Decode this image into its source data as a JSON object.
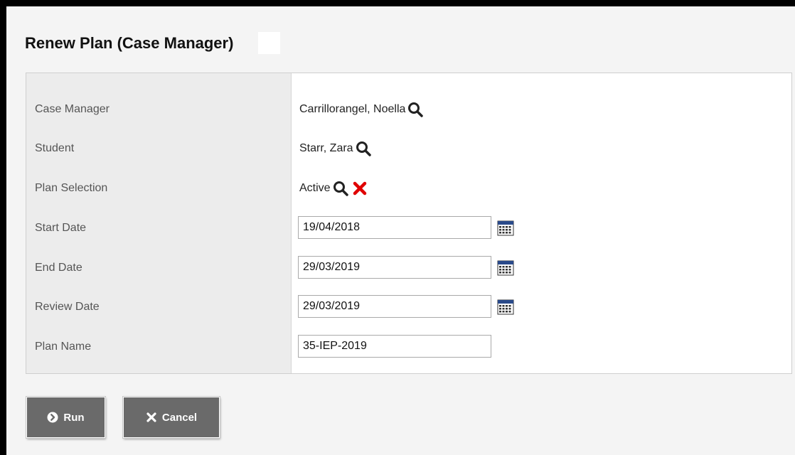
{
  "dialog": {
    "title": "Renew Plan (Case Manager)"
  },
  "form": {
    "fields": [
      {
        "label": "Case Manager",
        "value": "Carrillorangel, Noella"
      },
      {
        "label": "Student",
        "value": "Starr, Zara"
      },
      {
        "label": "Plan Selection",
        "value": "Active"
      },
      {
        "label": "Start Date",
        "value": "19/04/2018"
      },
      {
        "label": "End Date",
        "value": "29/03/2019"
      },
      {
        "label": "Review Date",
        "value": "29/03/2019"
      },
      {
        "label": "Plan Name",
        "value": "35-IEP-2019"
      }
    ]
  },
  "buttons": {
    "run_label": "Run",
    "cancel_label": "Cancel"
  },
  "icons": {
    "search": "search-icon",
    "clear": "clear-x-icon",
    "calendar": "calendar-icon",
    "run": "arrow-circle-right-icon",
    "cancel": "x-icon"
  },
  "colors": {
    "button_bg": "#6a6a6a",
    "clear_x": "#e00000",
    "calendar_header": "#2a4a8a"
  }
}
